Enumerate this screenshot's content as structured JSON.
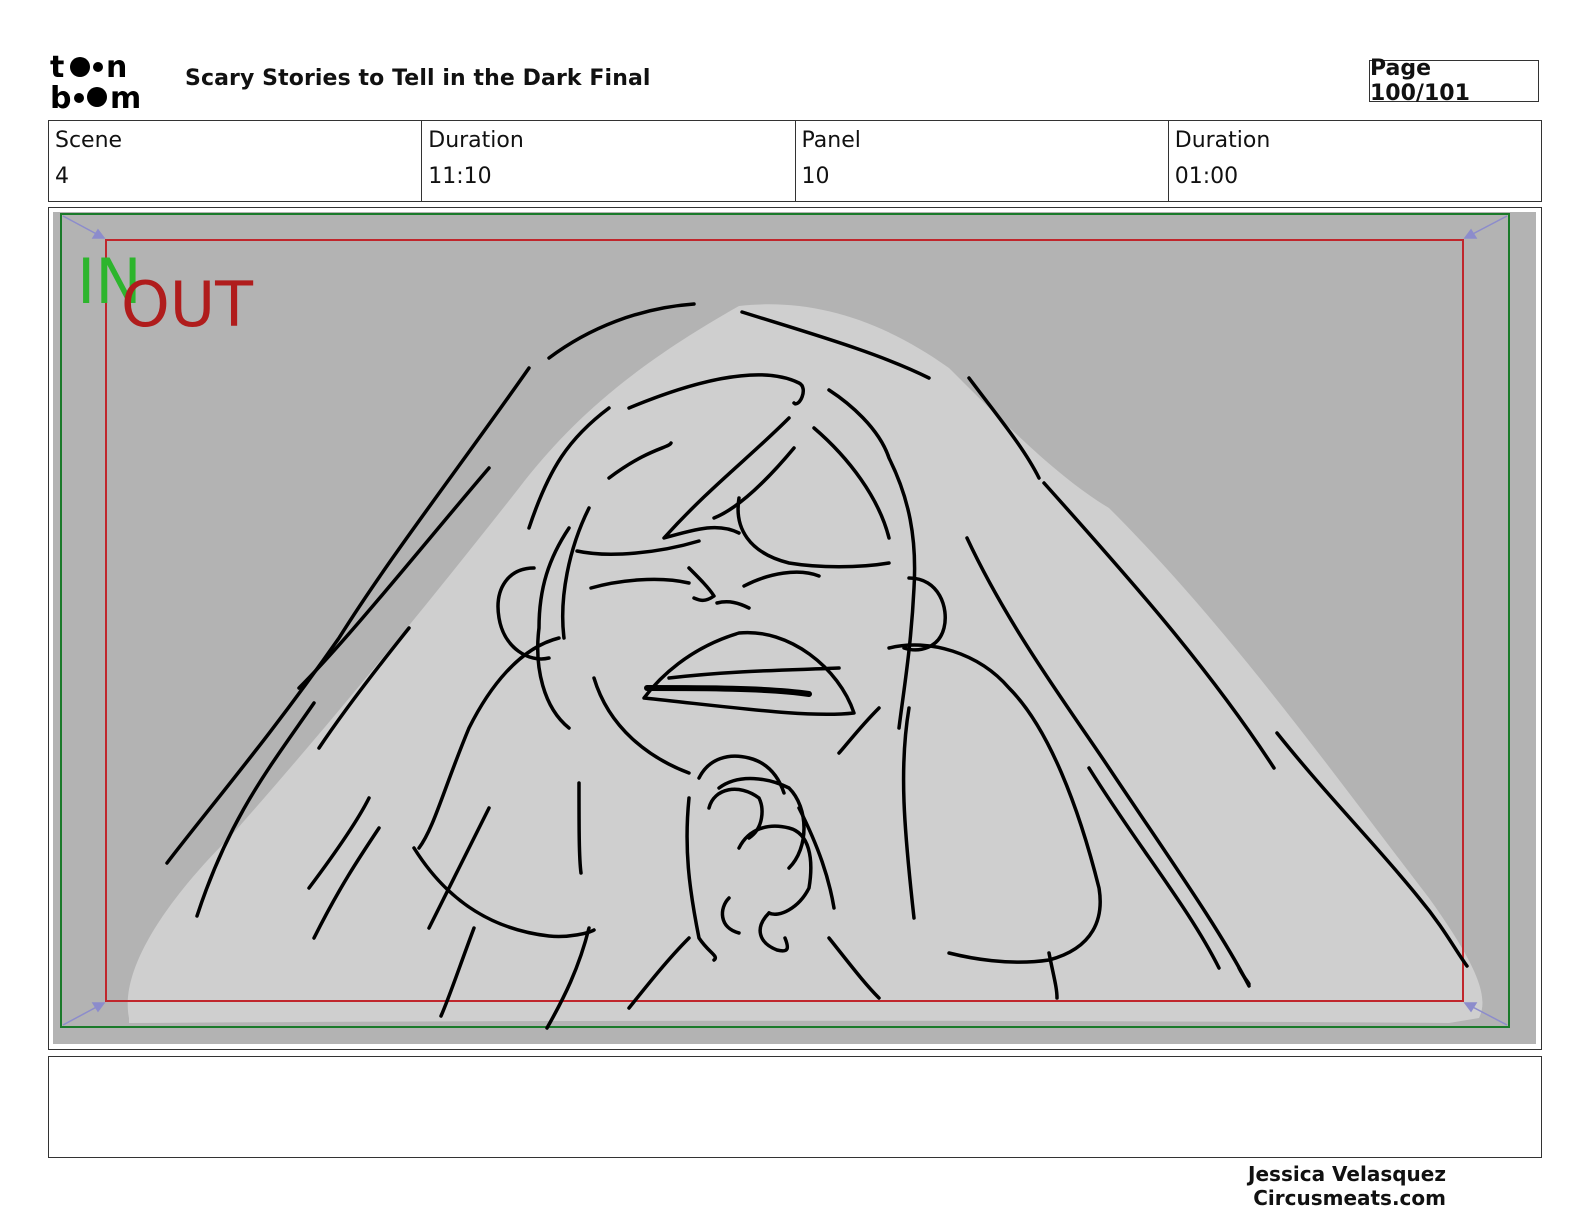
{
  "header": {
    "logo_text": "toon boom",
    "title": "Scary Stories to Tell in the Dark  Final",
    "page": "Page 100/101"
  },
  "info": {
    "scene_label": "Scene",
    "scene_value": "4",
    "scene_duration_label": "Duration",
    "scene_duration_value": "11:10",
    "panel_label": "Panel",
    "panel_value": "10",
    "panel_duration_label": "Duration",
    "panel_duration_value": "01:00"
  },
  "panel": {
    "in_label": "IN",
    "out_label": "OUT",
    "colors": {
      "background": "#b3b3b3",
      "blanket": "#cfcfcf",
      "in_frame": "#1a7a2a",
      "out_frame": "#c0262c",
      "in_text": "#2db52d",
      "out_text": "#b01c1c",
      "corner_arrows": "#8c8ccc"
    }
  },
  "notes": "",
  "credits": {
    "name": "Jessica Velasquez",
    "site": "Circusmeats.com"
  }
}
